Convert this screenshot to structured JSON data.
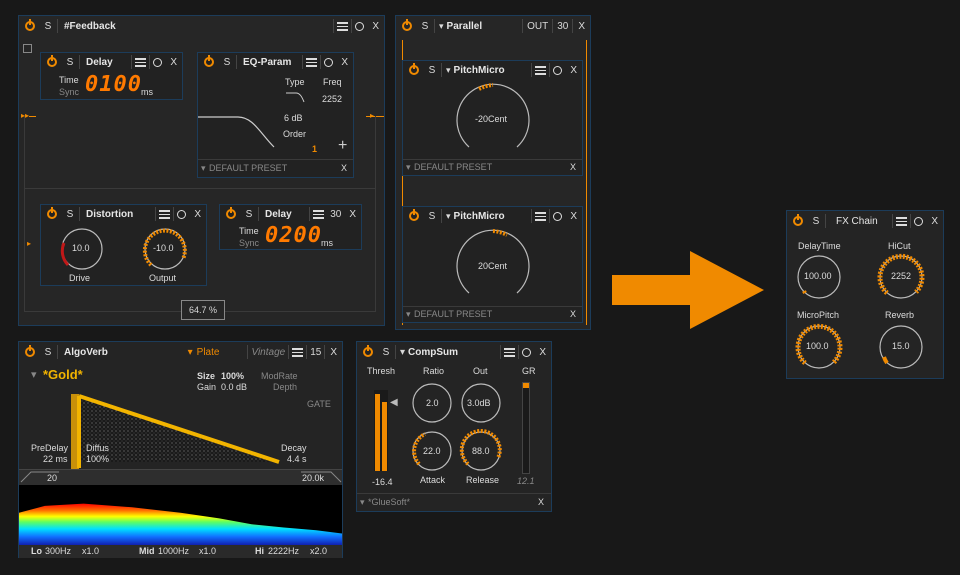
{
  "feedback": {
    "title": "#Feedback",
    "solo": "S",
    "close": "X"
  },
  "delay1": {
    "title": "Delay",
    "solo": "S",
    "close": "X",
    "time_label": "Time",
    "sync_label": "Sync",
    "value": "0100",
    "unit": "ms"
  },
  "eq": {
    "title": "EQ-Param",
    "solo": "S",
    "close": "X",
    "type_label": "Type",
    "freq_label": "Freq",
    "freq_value": "2252",
    "gain_value": "6 dB",
    "order_label": "Order",
    "order_value": "1",
    "plus": "+",
    "preset": "DEFAULT PRESET"
  },
  "distortion": {
    "title": "Distortion",
    "solo": "S",
    "close": "X",
    "drive_value": "10.0",
    "drive_label": "Drive",
    "output_value": "-10.0",
    "output_label": "Output"
  },
  "delay2": {
    "title": "Delay",
    "solo": "S",
    "count": "30",
    "close": "X",
    "time_label": "Time",
    "sync_label": "Sync",
    "value": "0200",
    "unit": "ms"
  },
  "mix_value": "64.7 %",
  "parallel": {
    "title": "Parallel",
    "solo": "S",
    "out": "OUT",
    "count": "30",
    "close": "X"
  },
  "pitch1": {
    "title": "PitchMicro",
    "solo": "S",
    "close": "X",
    "value": "-20Cent",
    "preset": "DEFAULT PRESET"
  },
  "pitch2": {
    "title": "PitchMicro",
    "solo": "S",
    "close": "X",
    "value": "20Cent",
    "preset": "DEFAULT PRESET"
  },
  "algoverb": {
    "title": "AlgoVerb",
    "solo": "S",
    "preset_tab": "Plate",
    "vintage": "Vintage",
    "count": "15",
    "close": "X",
    "preset_name": "*Gold*",
    "size_label": "Size",
    "size_value": "100%",
    "gain_label": "Gain",
    "gain_value": "0.0 dB",
    "modrate": "ModRate",
    "depth": "Depth",
    "gate": "GATE",
    "predelay_label": "PreDelay",
    "predelay_value": "22 ms",
    "diffus_label": "Diffus",
    "diffus_value": "100%",
    "decay_label": "Decay",
    "decay_value": "4.4 s",
    "lo_cut": "20",
    "hi_cut": "20.0k",
    "lo_label": "Lo",
    "lo_freq": "300Hz",
    "lo_mult": "x1.0",
    "mid_label": "Mid",
    "mid_freq": "1000Hz",
    "mid_mult": "x1.0",
    "hi_label": "Hi",
    "hi_freq": "2222Hz",
    "hi_mult": "x2.0"
  },
  "compsum": {
    "title": "CompSum",
    "solo": "S",
    "close": "X",
    "thresh_label": "Thresh",
    "ratio_label": "Ratio",
    "out_label": "Out",
    "gr_label": "GR",
    "ratio_value": "2.0",
    "out_value": "3.0dB",
    "attack_value": "22.0",
    "attack_label": "Attack",
    "release_value": "88.0",
    "release_label": "Release",
    "thresh_value": "-16.4",
    "gr_value": "12.1",
    "preset": "*GlueSoft*"
  },
  "fxchain": {
    "title": "FX Chain",
    "solo": "S",
    "close": "X",
    "delaytime_label": "DelayTime",
    "delaytime_value": "100.00",
    "hicut_label": "HiCut",
    "hicut_value": "2252",
    "micropitch_label": "MicroPitch",
    "micropitch_value": "100.0",
    "reverb_label": "Reverb",
    "reverb_value": "15.0"
  },
  "colors": {
    "accent": "#f08a00",
    "panel": "#262626",
    "border": "#1c3c5a",
    "background": "#181818"
  }
}
